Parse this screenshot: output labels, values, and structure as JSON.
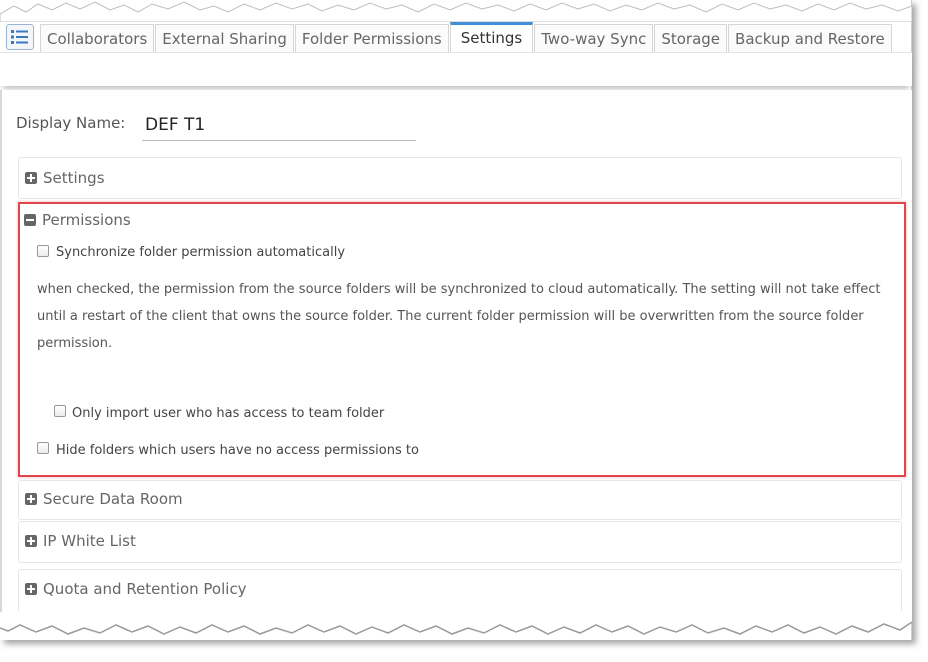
{
  "tabs": [
    {
      "label": "Collaborators",
      "active": false
    },
    {
      "label": "External Sharing",
      "active": false
    },
    {
      "label": "Folder Permissions",
      "active": false
    },
    {
      "label": "Settings",
      "active": true
    },
    {
      "label": "Two-way Sync",
      "active": false
    },
    {
      "label": "Storage",
      "active": false
    },
    {
      "label": "Backup and Restore",
      "active": false
    }
  ],
  "display_name": {
    "label": "Display Name:",
    "value": "DEF T1"
  },
  "sections": {
    "settings": {
      "title": "Settings",
      "expanded": false
    },
    "permissions": {
      "title": "Permissions",
      "expanded": true,
      "sync_checkbox": "Synchronize folder permission automatically",
      "description": "when checked, the permission from the source folders will be synchronized to cloud automatically. The setting will not take effect until a restart of the client that owns the source folder. The current folder permission will be overwritten from the source folder permission.",
      "import_checkbox": "Only import user who has access to team folder",
      "hide_checkbox": "Hide folders which users have no access permissions to"
    },
    "secure_data_room": {
      "title": "Secure Data Room",
      "expanded": false
    },
    "ip_white_list": {
      "title": "IP White List",
      "expanded": false
    },
    "quota": {
      "title": "Quota and Retention Policy",
      "expanded": false
    }
  },
  "colors": {
    "accent_tab": "#3f8fd8",
    "highlight_border": "#e0454a"
  }
}
